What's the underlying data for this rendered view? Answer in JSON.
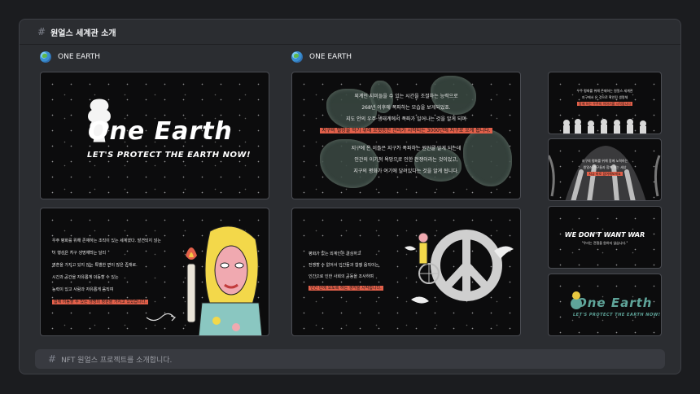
{
  "channel": {
    "name": "원얼스 세계관 소개"
  },
  "columns": [
    {
      "label": "ONE EARTH"
    },
    {
      "label": "ONE EARTH"
    }
  ],
  "slides": {
    "title": {
      "heading": "One Earth",
      "tagline": "LET'S PROTECT THE EARTH NOW!"
    },
    "story_lines": [
      "우주 평화를 위해 존재하는 조직이 있는 세계였다. 발견되지 않는",
      "이 행성은 지구 생명체라는 달리",
      "영혼을 가지고 있지 않는 특별한 면이 많은 존재로.",
      "시간과 공간을 자유롭게 이동할 수 있는",
      "능력이 있고 사람과 자유롭게 움직여",
      "함께 이동할 수 있는 생명의 정원을 가지고 있었습니다."
    ],
    "map_lines": [
      "외계인 지미들을 수 있는 시간을 조절하는 능력으로",
      "268년 이후에 폭파하는 모습을 보게되었죠.",
      "지도 안의 우주 생태계에서 폭파가 일어나는 것을 알게 되며",
      "지구의 멸망을 막기 위해 오랫동안 관리가 시작되는 3000년에 지구로 오게 됩니다.",
      "지구에 온 이들은 지구가 폭파하는 원인을 알게 되는데",
      "인간의 이기적 욕망으로 인한 전쟁이라는 것이었고,",
      "지구의 평화가 여기에 달려있다는 것을 알게 됩니다."
    ],
    "peace_lines": [
      "평화가 없는 외계인은 결심하고",
      "전쟁할 수 없어서 인간들과 함께 움직이는",
      "인간으로 인한 사회의 공동을 조사하며",
      "인간 안에 오도록 하는 생각을 시작합니다."
    ],
    "thumb1_lines": [
      "우주 평화를 위해 존재하는 원얼스 세계관",
      "지구에서 온 것으로 확인된 생명체",
      "함께 하는 우주의 이야기를 시작합니다"
    ],
    "thumb2_lines": [
      "지구의 평화를 위해 함께 노력하는",
      "원얼스 친구들과 함께 하는 세상",
      "지금 바로 참여해보세요"
    ],
    "war": {
      "heading": "WE DON'T WANT WAR",
      "sub": "\"우리는 전쟁을 원하지 않습니다.\""
    },
    "logo_small": {
      "heading": "One Earth",
      "tagline": "LET'S PROTECT THE EARTH NOW!"
    }
  },
  "composer": {
    "placeholder": "NFT 원얼스 프로젝트를 소개합니다."
  },
  "colors": {
    "highlight": "#e2604a",
    "accent_green": "#5fa59a",
    "background": "#2b2d31"
  },
  "icons": [
    "hash-icon",
    "globe-icon"
  ]
}
